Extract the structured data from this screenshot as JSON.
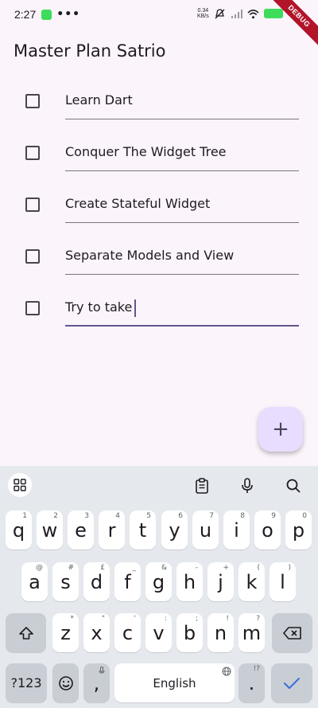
{
  "status_bar": {
    "time": "2:27",
    "dots": "•••",
    "speed_value": "0.34",
    "speed_unit": "KB/s",
    "battery": "95"
  },
  "debug_banner": "DEBUG",
  "app_bar": {
    "title": "Master Plan Satrio"
  },
  "tasks": [
    {
      "text": "Learn Dart",
      "checked": false
    },
    {
      "text": "Conquer The Widget Tree",
      "checked": false
    },
    {
      "text": "Create Stateful Widget",
      "checked": false
    },
    {
      "text": "Separate Models and View",
      "checked": false
    },
    {
      "text": "Try to take",
      "checked": false,
      "focused": true
    }
  ],
  "fab": {
    "symbol": "+"
  },
  "keyboard": {
    "row1": [
      {
        "k": "q",
        "h": "1"
      },
      {
        "k": "w",
        "h": "2"
      },
      {
        "k": "e",
        "h": "3"
      },
      {
        "k": "r",
        "h": "4"
      },
      {
        "k": "t",
        "h": "5"
      },
      {
        "k": "y",
        "h": "6"
      },
      {
        "k": "u",
        "h": "7"
      },
      {
        "k": "i",
        "h": "8"
      },
      {
        "k": "o",
        "h": "9"
      },
      {
        "k": "p",
        "h": "0"
      }
    ],
    "row2": [
      {
        "k": "a",
        "h": "@"
      },
      {
        "k": "s",
        "h": "#"
      },
      {
        "k": "d",
        "h": "£"
      },
      {
        "k": "f",
        "h": "_"
      },
      {
        "k": "g",
        "h": "&"
      },
      {
        "k": "h",
        "h": "-"
      },
      {
        "k": "j",
        "h": "+"
      },
      {
        "k": "k",
        "h": "("
      },
      {
        "k": "l",
        "h": ")"
      }
    ],
    "row3": [
      {
        "k": "z",
        "h": "*"
      },
      {
        "k": "x",
        "h": "\""
      },
      {
        "k": "c",
        "h": "'"
      },
      {
        "k": "v",
        "h": ":"
      },
      {
        "k": "b",
        "h": ";"
      },
      {
        "k": "n",
        "h": "!"
      },
      {
        "k": "m",
        "h": "?"
      }
    ],
    "symbols_label": "?123",
    "comma": ",",
    "space_label": "English",
    "period": ".",
    "period_hint": "!?"
  }
}
